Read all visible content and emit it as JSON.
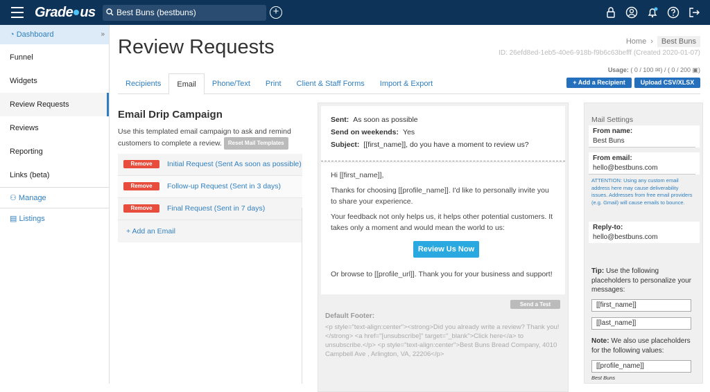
{
  "topbar": {
    "logo": "Grade.us",
    "logo_left": "Grade",
    "logo_right": "us",
    "search_value": "Best Buns (bestbuns)",
    "icons": [
      "lock-icon",
      "user-icon",
      "bell-icon",
      "help-icon",
      "logout-icon"
    ]
  },
  "sidebar": {
    "dashboard": "Dashboard",
    "items": [
      "Funnel",
      "Widgets",
      "Review Requests",
      "Reviews",
      "Reporting",
      "Links (beta)"
    ],
    "manage": "Manage",
    "listings": "Listings"
  },
  "page": {
    "title": "Review Requests",
    "breadcrumb_home": "Home",
    "breadcrumb_current": "Best Buns",
    "id_line": "ID: 26efd8ed-1eb5-40e6-918b-f9b6c63befff (Created 2020-01-07)",
    "usage_label": "Usage:",
    "usage_email": "( 0 / 100",
    "usage_sms": "/ ( 0 / 200",
    "add_recipient": "+ Add a Recipient",
    "upload_csv": "Upload CSV/XLSX"
  },
  "tabs": [
    "Recipients",
    "Email",
    "Phone/Text",
    "Print",
    "Client & Staff Forms",
    "Import & Export"
  ],
  "drip": {
    "title": "Email Drip Campaign",
    "description": "Use this templated email campaign to ask and remind customers to complete a review.",
    "reset_label": "Reset Mail Templates",
    "remove_label": "Remove",
    "emails": [
      "Initial Request (Sent As soon as possible)",
      "Follow-up Request (Sent in 3 days)",
      "Final Request (Sent in 7 days)"
    ],
    "add_email": "+ Add an Email"
  },
  "preview": {
    "sent_label": "Sent:",
    "sent_value": "As soon as possible",
    "weekends_label": "Send on weekends:",
    "weekends_value": "Yes",
    "subject_label": "Subject:",
    "subject_value": "[[first_name]], do you have a moment to review us?",
    "greeting": "Hi [[first_name]],",
    "para1": "Thanks for choosing [[profile_name]]. I'd like to personally invite you to share your experience.",
    "para2": "Your feedback not only helps us, it helps other potential customers. It takes only a moment and would mean the world to us:",
    "review_button": "Review Us Now",
    "para3": "Or browse to [[profile_url]]. Thank you for your business and support!",
    "send_test": "Send a Test",
    "footer_label": "Default Footer:",
    "footer_text": "<p style=\"text-align:center\"><strong>Did you already write a review? Thank you!</strong> <a href=\"[unsubscribe]\" target=\"_blank\">Click here</a> to unsubscribe.</p> <p style=\"text-align:center\">Best Buns Bread Company, 4010 Campbell Ave , Arlington, VA, 22206</p>"
  },
  "settings": {
    "heading": "Mail Settings",
    "from_name_label": "From name:",
    "from_name_value": "Best Buns",
    "from_email_label": "From email:",
    "from_email_value": "hello@bestbuns.com",
    "attention": "ATTENTION: Using any custom email address here may cause deliverability issues. Addresses from free email providers (e.g. Gmail) will cause emails to bounce.",
    "reply_to_label": "Reply-to:",
    "reply_to_value": "hello@bestbuns.com",
    "tip_bold": "Tip:",
    "tip_text": "Use the following placeholders to personalize your messages:",
    "placeholder_first": "[[first_name]]",
    "placeholder_last": "[[last_name]]",
    "note_bold": "Note:",
    "note_text": "We also use placeholders for the following values:",
    "placeholder_profile": "[[profile_name]]",
    "profile_example": "Best Buns"
  },
  "colors": {
    "topbar": "#0e3358",
    "accent": "#2f7fc0",
    "remove": "#e74c3c",
    "review_button": "#29a9df"
  }
}
